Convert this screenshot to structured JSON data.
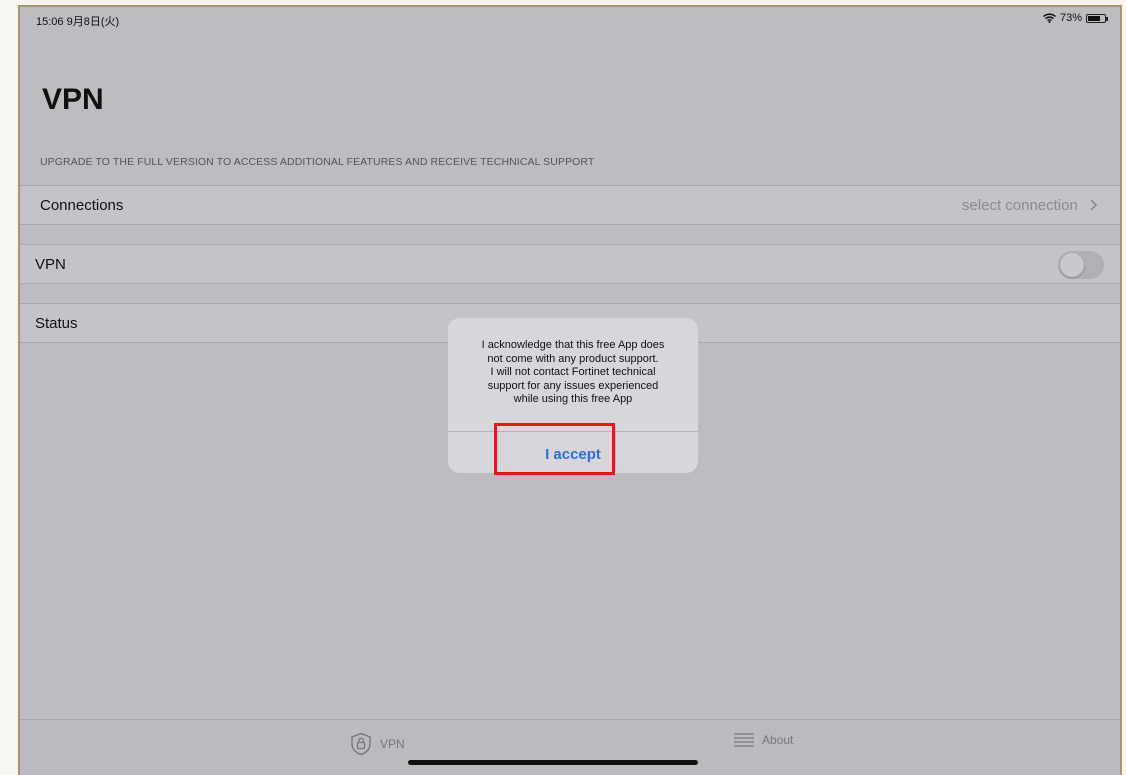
{
  "status_bar": {
    "time": "15:06  9月8日(火)",
    "battery": "73%",
    "wifi_icon": "wifi-icon",
    "battery_level": 0.73
  },
  "page": {
    "title": "VPN",
    "upgrade_notice": "UPGRADE TO THE FULL VERSION TO ACCESS ADDITIONAL FEATURES AND RECEIVE TECHNICAL SUPPORT"
  },
  "rows": {
    "connections": {
      "label": "Connections",
      "value": "select connection"
    },
    "vpn": {
      "label": "VPN",
      "toggle_on": false
    },
    "status": {
      "label": "Status"
    }
  },
  "dialog": {
    "message": "I acknowledge that this free App does\nnot come with any product support.\nI will not contact Fortinet technical\nsupport for any issues experienced\nwhile using this free App",
    "button": "I accept"
  },
  "tabbar": {
    "vpn_label": "VPN",
    "about_label": "About"
  },
  "colors": {
    "accent": "#2f6fd6",
    "highlight": "#e01919"
  }
}
